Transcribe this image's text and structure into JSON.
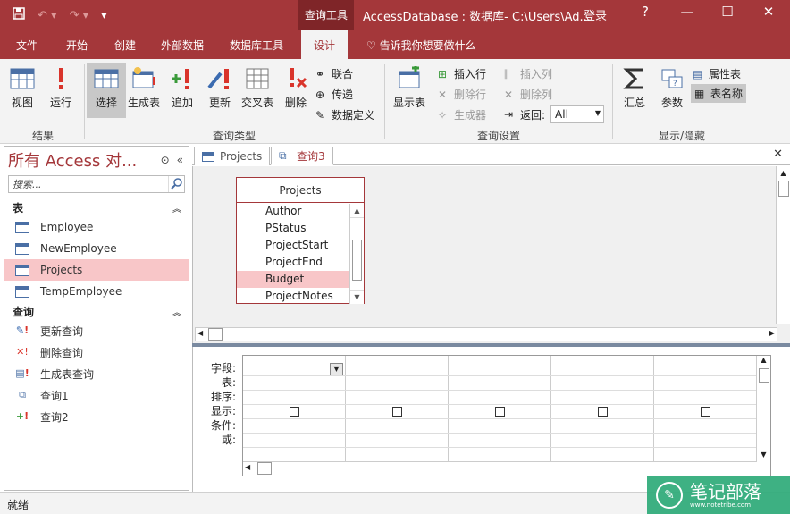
{
  "titlebar": {
    "context_tab": "查询工具",
    "title": "AccessDatabase : 数据库- C:\\Users\\Ad...",
    "login": "登录",
    "help": "?"
  },
  "tabs": [
    "文件",
    "开始",
    "创建",
    "外部数据",
    "数据库工具",
    "设计"
  ],
  "tellme": "告诉我你想要做什么",
  "ribbon": {
    "results": {
      "view": "视图",
      "run": "运行",
      "label": "结果"
    },
    "querytype": {
      "select": "选择",
      "maketable": "生成表",
      "append": "追加",
      "update": "更新",
      "crosstab": "交叉表",
      "delete": "删除",
      "union": "联合",
      "passthrough": "传递",
      "datadef": "数据定义",
      "label": "查询类型"
    },
    "setup": {
      "showtable": "显示表",
      "insertrows": "插入行",
      "deleterows": "删除行",
      "builder": "生成器",
      "insertcols": "插入列",
      "deletecols": "删除列",
      "return_label": "返回:",
      "return_value": "All",
      "label": "查询设置"
    },
    "showhide": {
      "totals": "汇总",
      "params": "参数",
      "propsheet": "属性表",
      "tablenames": "表名称",
      "label": "显示/隐藏"
    }
  },
  "nav": {
    "title": "所有 Access 对...",
    "search": "搜索...",
    "cat_tables": "表",
    "tables": [
      "Employee",
      "NewEmployee",
      "Projects",
      "TempEmployee"
    ],
    "cat_queries": "查询",
    "queries": [
      "更新查询",
      "删除查询",
      "生成表查询",
      "查询1",
      "查询2"
    ]
  },
  "doctabs": [
    "Projects",
    "查询3"
  ],
  "table": {
    "name": "Projects",
    "fields": [
      "Author",
      "PStatus",
      "ProjectStart",
      "ProjectEnd",
      "Budget",
      "ProjectNotes"
    ]
  },
  "grid": {
    "rows": [
      "字段:",
      "表:",
      "排序:",
      "显示:",
      "条件:",
      "或:"
    ]
  },
  "status": "就绪",
  "watermark": {
    "name": "笔记部落",
    "url": "www.notetribe.com"
  }
}
